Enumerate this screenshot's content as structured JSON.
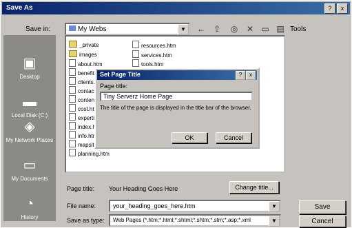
{
  "window": {
    "title": "Save As",
    "help_icon": "?",
    "close_icon": "x"
  },
  "save_in": {
    "label": "Save in:",
    "value": "My Webs"
  },
  "toolbar": {
    "tools_label": "Tools",
    "icons": [
      "back-arrow-icon",
      "up-folder-icon",
      "search-web-icon",
      "delete-icon",
      "new-folder-icon",
      "views-icon"
    ]
  },
  "places": [
    {
      "label": "Desktop",
      "icon": "desktop-icon"
    },
    {
      "label": "Local Disk (C:)",
      "icon": "disk-icon"
    },
    {
      "label": "My Network Places",
      "icon": "network-icon"
    },
    {
      "label": "My Documents",
      "icon": "documents-icon"
    },
    {
      "label": "History",
      "icon": "history-icon"
    }
  ],
  "files": {
    "col1": [
      {
        "name": "_private",
        "type": "folder"
      },
      {
        "name": "images",
        "type": "folder"
      },
      {
        "name": "about.htm",
        "type": "file"
      },
      {
        "name": "benefits.htm",
        "type": "file"
      },
      {
        "name": "clients.htm",
        "type": "file"
      },
      {
        "name": "contact.htm",
        "type": "file"
      },
      {
        "name": "contents.htm",
        "type": "file"
      },
      {
        "name": "cost.htm",
        "type": "file"
      },
      {
        "name": "expertise.htm",
        "type": "file"
      },
      {
        "name": "index.htm",
        "type": "file"
      },
      {
        "name": "info.htm",
        "type": "file"
      },
      {
        "name": "mapsite.htm",
        "type": "file"
      },
      {
        "name": "planning.htm",
        "type": "file"
      }
    ],
    "col2": [
      {
        "name": "resources.htm",
        "type": "file"
      },
      {
        "name": "services.htm",
        "type": "file"
      },
      {
        "name": "tools.htm",
        "type": "file"
      }
    ]
  },
  "page_title_row": {
    "label": "Page title:",
    "value": "Your Heading Goes Here",
    "change_button": "Change title..."
  },
  "file_name": {
    "label": "File name:",
    "value": "your_heading_goes_here.htm"
  },
  "save_as_type": {
    "label": "Save as type:",
    "value": "Web Pages (*.htm;*.html;*.shtml;*.shtm;*.stm;*.asp;*.xml"
  },
  "buttons": {
    "save": "Save",
    "cancel": "Cancel"
  },
  "set_title_dialog": {
    "title": "Set Page Title",
    "field_label": "Page title:",
    "field_value": "Tiny Serverz Home Page",
    "description": "The title of the page is displayed in the title bar of the browser.",
    "ok": "OK",
    "cancel": "Cancel",
    "help_icon": "?",
    "close_icon": "x"
  }
}
